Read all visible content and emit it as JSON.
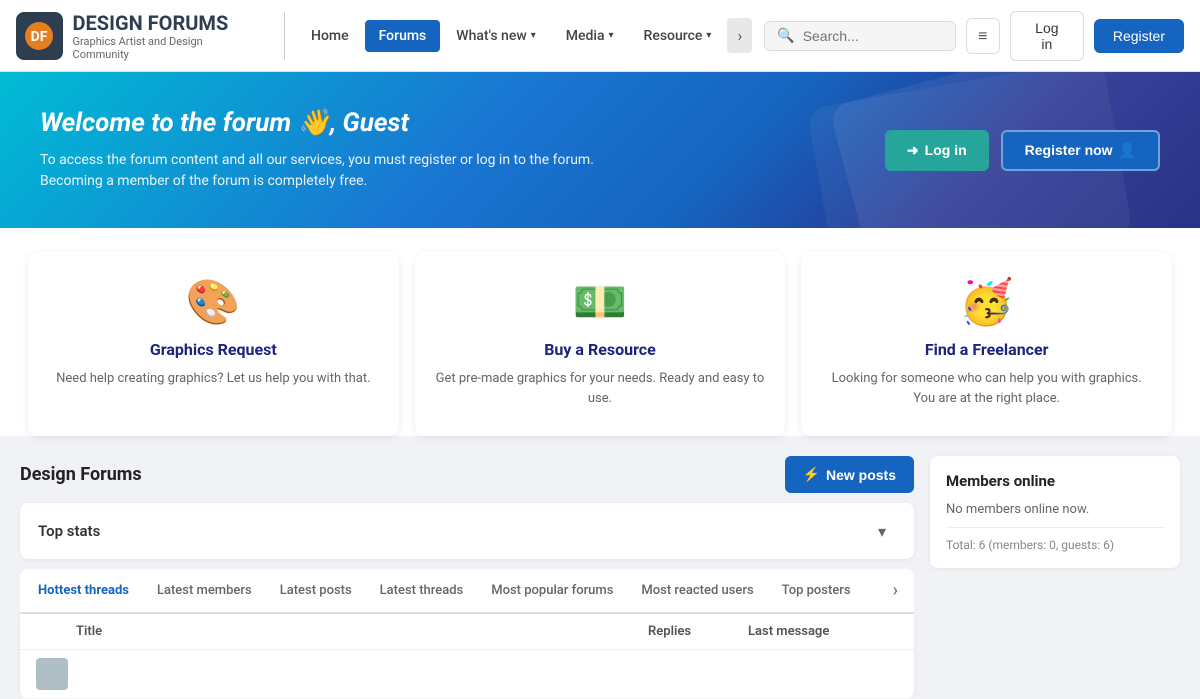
{
  "site": {
    "logo_letter": "DF",
    "title": "DESIGN FORUMS",
    "subtitle": "Graphics Artist and Design Community"
  },
  "nav": {
    "items": [
      {
        "id": "home",
        "label": "Home",
        "active": false
      },
      {
        "id": "forums",
        "label": "Forums",
        "active": true
      },
      {
        "id": "whats_new",
        "label": "What's new",
        "active": false,
        "has_dropdown": true
      },
      {
        "id": "media",
        "label": "Media",
        "active": false,
        "has_dropdown": true
      },
      {
        "id": "resources",
        "label": "Resource",
        "active": false,
        "has_dropdown": true
      }
    ]
  },
  "search": {
    "placeholder": "Search..."
  },
  "header_buttons": {
    "login": "Log in",
    "register": "Register"
  },
  "hero": {
    "title": "Welcome to the forum 👋, Guest",
    "description": "To access the forum content and all our services, you must register or log in to the forum. Becoming a member of the forum is completely free.",
    "login_btn": "Log in",
    "register_btn": "Register now"
  },
  "features": [
    {
      "icon": "🎨",
      "title": "Graphics Request",
      "description": "Need help creating graphics? Let us help you with that."
    },
    {
      "icon": "💵",
      "title": "Buy a Resource",
      "description": "Get pre-made graphics for your needs. Ready and easy to use."
    },
    {
      "icon": "🥳",
      "title": "Find a Freelancer",
      "description": "Looking for someone who can help you with graphics. You are at the right place."
    }
  ],
  "main_section": {
    "title": "Design Forums",
    "new_posts_btn": "New posts"
  },
  "stats": {
    "label": "Top stats"
  },
  "tabs": [
    {
      "id": "hottest",
      "label": "Hottest threads",
      "active": true
    },
    {
      "id": "latest_members",
      "label": "Latest members",
      "active": false
    },
    {
      "id": "latest_posts",
      "label": "Latest posts",
      "active": false
    },
    {
      "id": "latest_threads",
      "label": "Latest threads",
      "active": false
    },
    {
      "id": "popular_forums",
      "label": "Most popular forums",
      "active": false
    },
    {
      "id": "reacted_users",
      "label": "Most reacted users",
      "active": false
    },
    {
      "id": "top_posters",
      "label": "Top posters",
      "active": false
    }
  ],
  "table": {
    "headers": [
      "",
      "Title",
      "Replies",
      "Last message"
    ],
    "rows": []
  },
  "members_online": {
    "title": "Members online",
    "no_members": "No members online now.",
    "total": "Total: 6 (members: 0, guests: 6)"
  }
}
